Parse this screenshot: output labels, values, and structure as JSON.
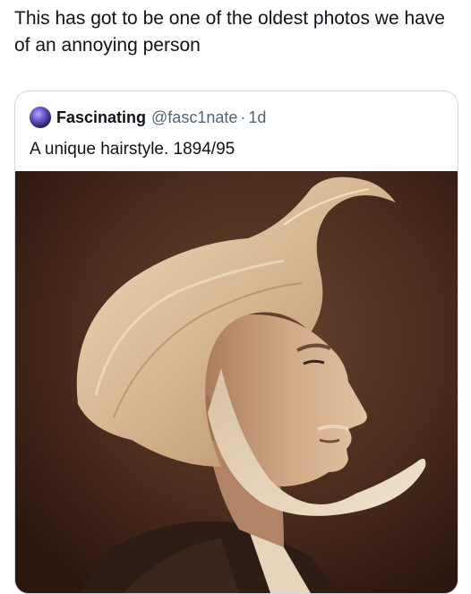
{
  "post": {
    "text": "This has got to be one of the oldest photos we have of an annoying person"
  },
  "quote": {
    "display_name": "Fascinating",
    "handle": "@fasc1nate",
    "separator": "·",
    "time": "1d",
    "text": "A unique hairstyle. 1894/95",
    "avatar_icon": "galaxy-avatar",
    "photo": "sepia-portrait-man-swept-hair-sideburns"
  }
}
